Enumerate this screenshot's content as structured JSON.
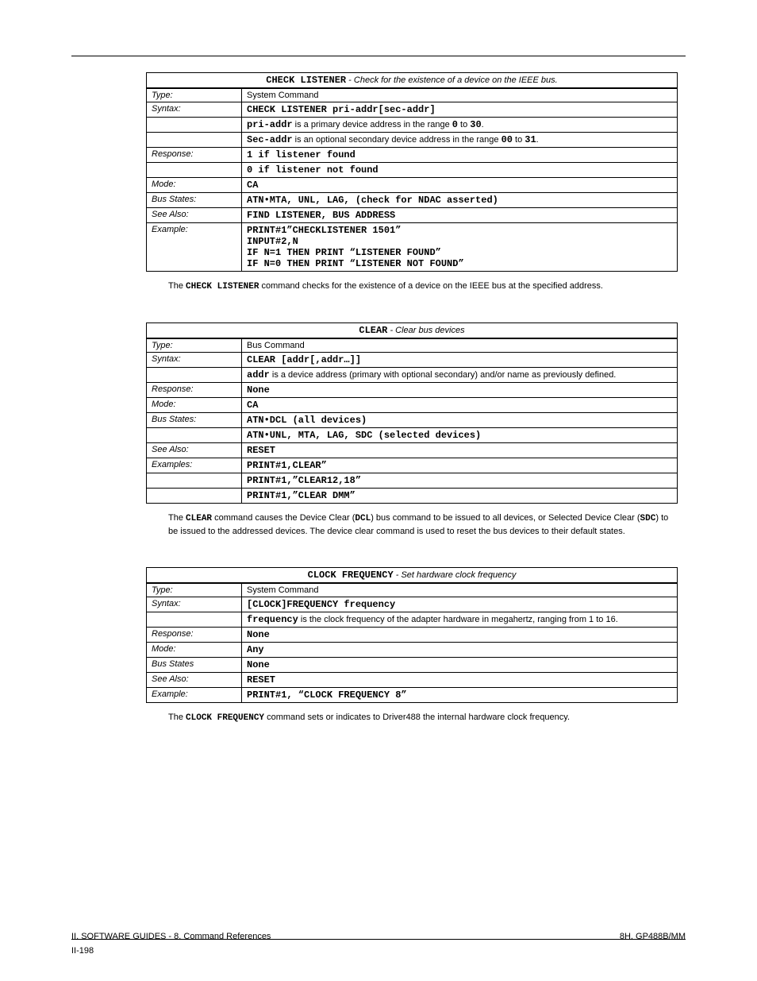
{
  "check_listener": {
    "title_html": "<span class='mono-segment'>CHECK LISTENER</span> - Check for the existence of a device on the IEEE bus.",
    "rows": [
      {
        "label": "Type:",
        "value_html": "System Command"
      },
      {
        "label": "Syntax:",
        "value_html": "<span class='mono-segment'>CHECK LISTENER pri-addr[sec-addr]</span>"
      },
      {
        "label": "",
        "value_html": "<span class='mono-segment'>pri-addr</span> is a primary device address in the range <span class='mono-segment'>0</span> to <span class='mono-segment'>30</span>."
      },
      {
        "label": "",
        "value_html": "<span class='mono-segment'>Sec-addr</span> is an optional secondary device address in the range <span class='mono-segment'>00</span> to <span class='mono-segment'>31</span>."
      },
      {
        "label": "Response:",
        "value_html": "<span class='mono-segment'>1 if listener found</span>"
      },
      {
        "label": "",
        "value_html": "<span class='mono-segment'>0 if listener not found</span>"
      },
      {
        "label": "Mode:",
        "value_html": "<span class='mono-segment'>CA</span>"
      },
      {
        "label": "Bus States:",
        "value_html": "<span class='mono-segment'>ATN&bull;MTA, UNL, LAG, (check for NDAC asserted)</span>"
      },
      {
        "label": "See Also:",
        "value_html": "<span class='mono-segment'>FIND LISTENER, BUS ADDRESS</span>"
      },
      {
        "label": "Example:",
        "value_html": "<span class='mono-segment'>PRINT#1&rdquo;CHECKLISTENER 1501&rdquo;<br>INPUT#2,N<br>IF N=1 THEN PRINT &ldquo;LISTENER FOUND&rdquo;<br>IF N=0 THEN PRINT &ldquo;LISTENER NOT FOUND&rdquo;</span>"
      }
    ],
    "caption_html": "The <span class='mono-segment'>CHECK LISTENER</span> command checks for the existence of a device on the IEEE bus at the specified address."
  },
  "clear": {
    "title_html": "<span class='mono-segment'>CLEAR</span> - Clear bus devices",
    "rows": [
      {
        "label": "Type:",
        "value_html": "Bus Command"
      },
      {
        "label": "Syntax:",
        "value_html": "<span class='mono-segment'>CLEAR [addr[,addr&hellip;]]</span>"
      },
      {
        "label": "",
        "value_html": "<span class='mono-segment'>addr</span> is a device address (primary with optional secondary) and/or name as previously defined."
      },
      {
        "label": "Response:",
        "value_html": "<span class='mono-segment'>None</span>"
      },
      {
        "label": "Mode:",
        "value_html": "<span class='mono-segment'>CA</span>"
      },
      {
        "label": "Bus States:",
        "value_html": "<span class='mono-segment'>ATN&bull;DCL (all devices)</span>"
      },
      {
        "label": "",
        "value_html": "<span class='mono-segment'>ATN&bull;UNL, MTA, LAG, SDC (selected devices)</span>"
      },
      {
        "label": "See Also:",
        "value_html": "<span class='mono-segment'>RESET</span>"
      },
      {
        "label": "Examples:",
        "value_html": "<span class='mono-segment'>PRINT#1,CLEAR&rdquo;</span>"
      },
      {
        "label": "",
        "value_html": "<span class='mono-segment'>PRINT#1,&rdquo;CLEAR12,18&rdquo;</span>"
      },
      {
        "label": "",
        "value_html": "<span class='mono-segment'>PRINT#1,&rdquo;CLEAR DMM&rdquo;</span>"
      }
    ],
    "caption_html": "The <span class='mono-segment'>CLEAR</span> command causes the Device Clear (<span class='mono-segment'>DCL</span>) bus command to be issued to all devices, or Selected Device Clear (<span class='mono-segment'>SDC</span>) to be issued to the addressed devices. The device clear command is used to reset the bus devices to their default states."
  },
  "clock_frequency": {
    "title_html": "<span class='mono-segment'>CLOCK FREQUENCY</span> - Set hardware clock frequency",
    "rows": [
      {
        "label": "Type:",
        "value_html": "System Command"
      },
      {
        "label": "Syntax:",
        "value_html": "<span class='mono-segment'>[CLOCK]FREQUENCY frequency</span>"
      },
      {
        "label": "",
        "value_html": "<span class='mono-segment'>frequency</span> is the clock frequency of the adapter hardware in megahertz, ranging from 1 to 16."
      },
      {
        "label": "Response:",
        "value_html": "<span class='mono-segment'>None</span>"
      },
      {
        "label": "Mode:",
        "value_html": "<span class='mono-segment'>Any</span>"
      },
      {
        "label": "Bus States",
        "value_html": "<span class='mono-segment'>None</span>"
      },
      {
        "label": "See Also:",
        "value_html": "<span class='mono-segment'>RESET</span>"
      },
      {
        "label": "Example:",
        "value_html": "<span class='mono-segment'>PRINT#1, &ldquo;CLOCK FREQUENCY 8&rdquo;</span>"
      }
    ],
    "caption_html": "The <span class='mono-segment'>CLOCK FREQUENCY</span> command sets or indicates to Driver488 the internal hardware clock frequency."
  },
  "left_label": "II. SOFTWARE GUIDES - 8. Command References",
  "right_label": "8H. GP488B/MM",
  "page_number": "II-198"
}
